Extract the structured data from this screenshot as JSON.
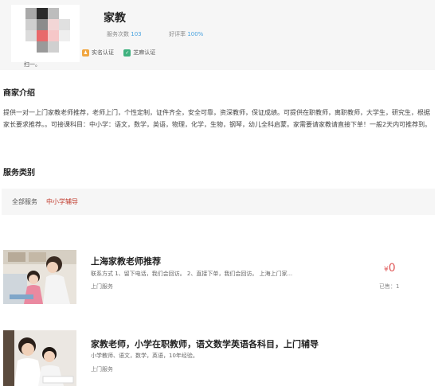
{
  "merchant": {
    "name": "家教",
    "qr_caption": "扫一。",
    "stats": {
      "service_count_label": "服务次数",
      "service_count": "103",
      "rating_label": "好评率",
      "rating": "100%"
    },
    "certs": [
      {
        "label": "实名认证",
        "icon": "id-verified-icon"
      },
      {
        "label": "芝麻认证",
        "icon": "sesame-verified-icon"
      }
    ]
  },
  "intro": {
    "title": "商家介绍",
    "text": "提供一对一上门家教老师推荐，老师上门，个性定制，证件齐全，安全可靠，资深教师，保证成绩。可提供在职教师，离职教师，大学生，研究生，根据家长要求推荐。。可接课科目：中小学：语文，数学，英语，物理，化学，生物，钢琴，幼儿全科启蒙。家需要请家教请直接下单！一般2天内可推荐到。"
  },
  "service_category": {
    "title": "服务类别",
    "all_label": "全部服务",
    "selected": "中小学辅导"
  },
  "services": [
    {
      "title": "上海家教老师推荐",
      "desc": "联系方式 1、留下电话，我们会回访。 2、直接下单，我们会回访。 上海上门家...",
      "tag": "上门服务",
      "currency": "¥",
      "price": "0",
      "sold": "已售：1"
    },
    {
      "title": "家教老师，小学在职教师，语文数学英语各科目，上门辅导",
      "desc": "小学教师、语文，数学，英语，10年经验。",
      "tag": "上门服务"
    }
  ],
  "colors": {
    "accent_red": "#c0392b",
    "price_red": "#e05a5a",
    "stat_blue": "#4aa3df",
    "card_bg": "#f6f6f6"
  }
}
